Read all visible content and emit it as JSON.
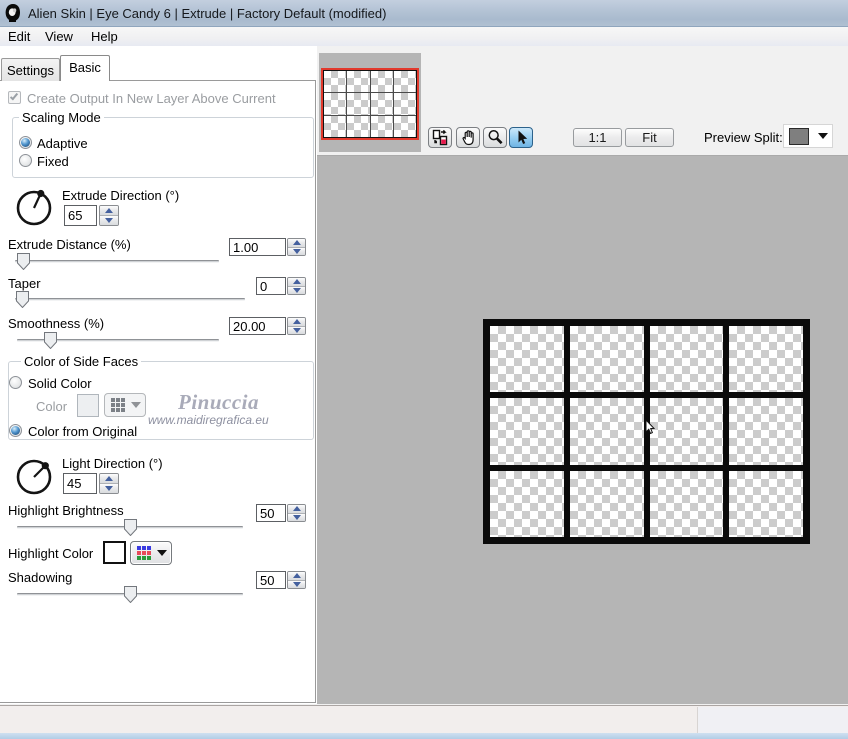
{
  "window": {
    "title": "Alien Skin | Eye Candy 6 | Extrude | Factory Default (modified)",
    "app_icon": "alien-skin-skull-icon"
  },
  "menu": {
    "items": [
      {
        "label": "Edit"
      },
      {
        "label": "View"
      },
      {
        "label": "Help"
      }
    ]
  },
  "tabs": [
    {
      "label": "Settings",
      "active": false
    },
    {
      "label": "Basic",
      "active": true
    }
  ],
  "controls": {
    "create_output": {
      "label": "Create Output In New Layer Above Current",
      "checked": true,
      "enabled": false
    },
    "scaling_mode": {
      "title": "Scaling Mode",
      "options": [
        {
          "label": "Adaptive",
          "selected": true
        },
        {
          "label": "Fixed",
          "selected": false
        }
      ]
    },
    "extrude_direction": {
      "label": "Extrude Direction (°)",
      "value": "65"
    },
    "extrude_distance": {
      "label": "Extrude Distance (%)",
      "value": "1.00"
    },
    "taper": {
      "label": "Taper",
      "value": "0"
    },
    "smoothness": {
      "label": "Smoothness (%)",
      "value": "20.00"
    },
    "side_faces": {
      "title": "Color of Side Faces",
      "solid_color_label": "Solid Color",
      "color_label": "Color",
      "from_original_label": "Color from Original",
      "solid_selected": false,
      "from_original_selected": true
    },
    "light_direction": {
      "label": "Light Direction (°)",
      "value": "45"
    },
    "highlight_brightness": {
      "label": "Highlight Brightness",
      "value": "50"
    },
    "highlight_color": {
      "label": "Highlight Color",
      "swatch_color": "#ffffff"
    },
    "shadowing": {
      "label": "Shadowing",
      "value": "50"
    }
  },
  "watermark": {
    "name": "Pinuccia",
    "url": "www.maidiregrafica.eu"
  },
  "preview": {
    "toolbar": {
      "icons": [
        {
          "name": "before-after-icon",
          "active": false
        },
        {
          "name": "hand-icon",
          "active": false
        },
        {
          "name": "magnifier-icon",
          "active": false
        },
        {
          "name": "cursor-icon",
          "active": true
        }
      ],
      "zoom_actual_label": "1:1",
      "zoom_fit_label": "Fit",
      "preview_split_label": "Preview Split:",
      "preview_split_swatch": "#7f7f7f"
    },
    "image": {
      "grid_columns": 4,
      "grid_rows": 3,
      "thumbnail_border": "#e2392c"
    }
  },
  "colors": {
    "titlebar": "#b4c3d5",
    "preview_background": "#b5b5b5",
    "selection_blue": "#2c628b",
    "spinner_arrow": "#44609e"
  }
}
